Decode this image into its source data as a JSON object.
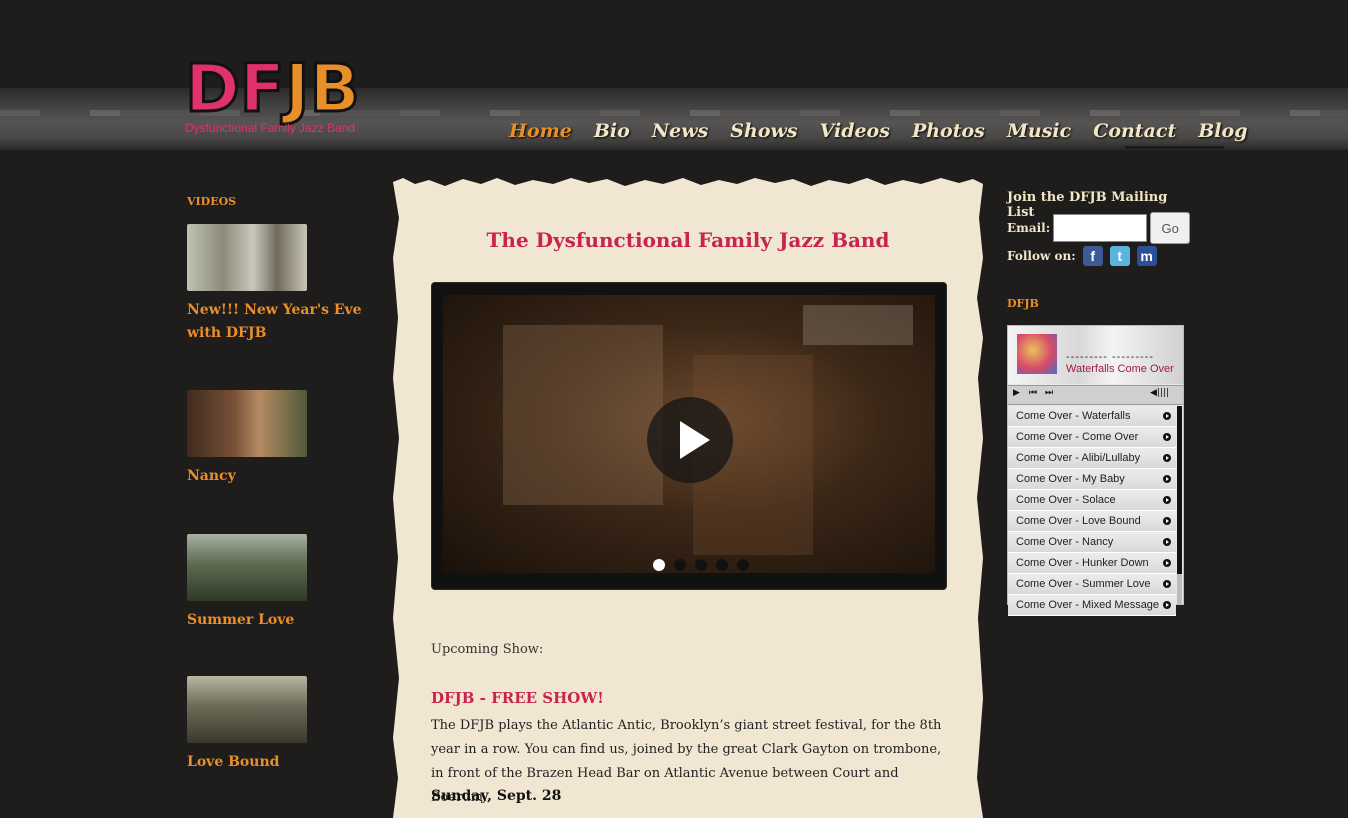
{
  "logo": {
    "letters": [
      "D",
      "F",
      "J",
      "B"
    ],
    "tagline": "Dysfunctional Family Jazz Band"
  },
  "nav": [
    {
      "label": "Home",
      "active": true
    },
    {
      "label": "Bio"
    },
    {
      "label": "News"
    },
    {
      "label": "Shows"
    },
    {
      "label": "Videos"
    },
    {
      "label": "Photos"
    },
    {
      "label": "Music"
    },
    {
      "label": "Contact"
    },
    {
      "label": "Blog"
    }
  ],
  "videos": {
    "title": "VIDEOS",
    "items": [
      {
        "title": "New!!! New Year's Eve with DFJB"
      },
      {
        "title": "Nancy"
      },
      {
        "title": "Summer Love"
      },
      {
        "title": "Love Bound"
      }
    ]
  },
  "main": {
    "title": "The Dysfunctional Family Jazz Band",
    "upcoming_label": "Upcoming Show:",
    "show_title": "DFJB - FREE SHOW!",
    "show_desc": "The DFJB plays the Atlantic Antic, Brooklyn’s giant street festival, for the 8th year in a row. You can find us, joined by the great Clark Gayton on trombone, in front of the Brazen Head Bar on Atlantic Avenue between Court and Boerum.",
    "show_date": "Sunday, Sept. 28"
  },
  "mailing": {
    "title": "Join the DFJB Mailing List",
    "email_label": "Email:",
    "go_label": "Go",
    "follow_label": "Follow on:",
    "social": [
      "facebook-icon",
      "twitter-icon",
      "myspace-icon"
    ]
  },
  "player": {
    "section_title": "DFJB",
    "dashes": "---------  ---------",
    "now_playing": "Waterfalls Come Over",
    "playlist": [
      "Come Over - Waterfalls",
      "Come Over - Come Over",
      "Come Over - Alibi/Lullaby",
      "Come Over - My Baby",
      "Come Over - Solace",
      "Come Over - Love Bound",
      "Come Over - Nancy",
      "Come Over - Hunker Down",
      "Come Over - Summer Love",
      "Come Over - Mixed Message"
    ]
  },
  "colors": {
    "accent_orange": "#e98f2a",
    "accent_pink": "#e0316a",
    "paper": "#f1e6d2",
    "nav_text": "#f1e6c6"
  }
}
